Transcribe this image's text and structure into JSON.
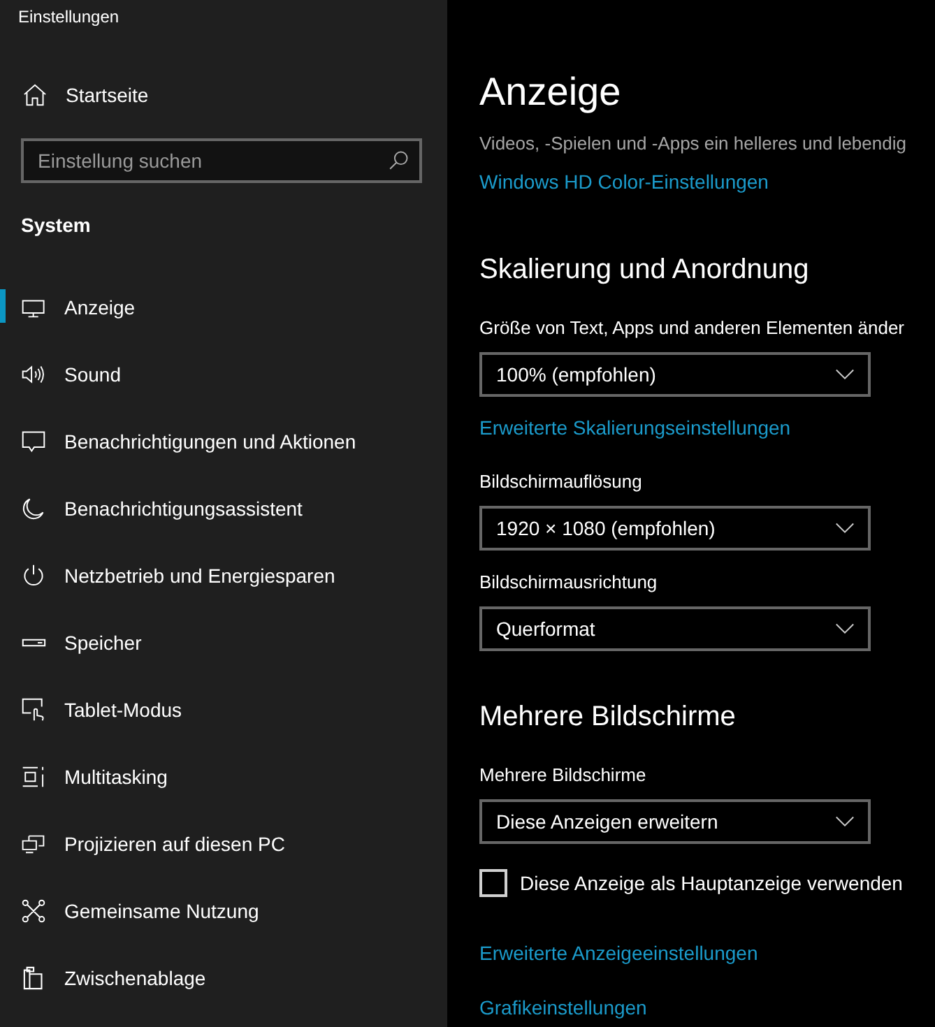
{
  "window": {
    "title": "Einstellungen"
  },
  "sidebar": {
    "home": {
      "label": "Startseite"
    },
    "search": {
      "placeholder": "Einstellung suchen"
    },
    "section": "System",
    "items": [
      {
        "label": "Anzeige",
        "selected": true
      },
      {
        "label": "Sound",
        "selected": false
      },
      {
        "label": "Benachrichtigungen und Aktionen",
        "selected": false
      },
      {
        "label": "Benachrichtigungsassistent",
        "selected": false
      },
      {
        "label": "Netzbetrieb und Energiesparen",
        "selected": false
      },
      {
        "label": "Speicher",
        "selected": false
      },
      {
        "label": "Tablet-Modus",
        "selected": false
      },
      {
        "label": "Multitasking",
        "selected": false
      },
      {
        "label": "Projizieren auf diesen PC",
        "selected": false
      },
      {
        "label": "Gemeinsame Nutzung",
        "selected": false
      },
      {
        "label": "Zwischenablage",
        "selected": false
      }
    ]
  },
  "page": {
    "title": "Anzeige",
    "content": [
      {
        "kind": "text",
        "text": "Videos, -Spielen und -Apps ein helleres und lebendig"
      },
      {
        "kind": "link",
        "text": "Windows HD Color-Einstellungen"
      },
      {
        "kind": "heading",
        "text": "Skalierung und Anordnung"
      },
      {
        "kind": "label",
        "text": "Größe von Text, Apps und anderen Elementen änder"
      },
      {
        "kind": "dropdown",
        "value": "100% (empfohlen)"
      },
      {
        "kind": "link",
        "text": "Erweiterte Skalierungseinstellungen"
      },
      {
        "kind": "label",
        "text": "Bildschirmauflösung"
      },
      {
        "kind": "dropdown",
        "value": "1920 × 1080 (empfohlen)"
      },
      {
        "kind": "label",
        "text": "Bildschirmausrichtung"
      },
      {
        "kind": "dropdown",
        "value": "Querformat"
      },
      {
        "kind": "heading",
        "text": "Mehrere Bildschirme"
      },
      {
        "kind": "label",
        "text": "Mehrere Bildschirme"
      },
      {
        "kind": "dropdown",
        "value": "Diese Anzeigen erweitern"
      },
      {
        "kind": "checkbox",
        "text": "Diese Anzeige als Hauptanzeige verwenden",
        "checked": false
      },
      {
        "kind": "link",
        "text": "Erweiterte Anzeigeeinstellungen"
      },
      {
        "kind": "link",
        "text": "Grafikeinstellungen"
      }
    ]
  }
}
